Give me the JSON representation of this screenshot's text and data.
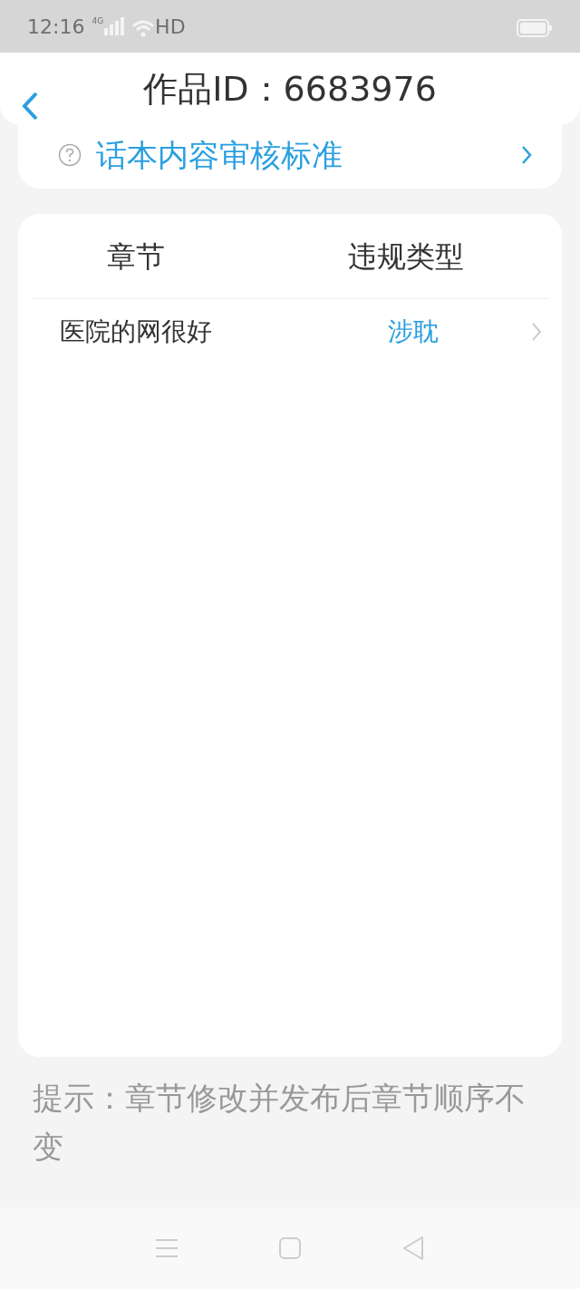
{
  "status_bar": {
    "time": "12:16",
    "network": "4G",
    "wifi_label": "HD"
  },
  "header": {
    "title": "作品ID：6683976"
  },
  "standard_link": {
    "label": "话本内容审核标准"
  },
  "table": {
    "columns": [
      "章节",
      "违规类型"
    ],
    "rows": [
      {
        "chapter": "医院的网很好",
        "violation": "涉耽"
      }
    ]
  },
  "tip": "提示：章节修改并发布后章节顺序不变"
}
